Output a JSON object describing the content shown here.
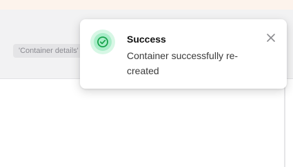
{
  "background": {
    "tooltip_text": "'Container details'"
  },
  "toast": {
    "title": "Success",
    "message": "Container successfully re-created",
    "icon": "check-circle-icon",
    "close_icon": "close-icon",
    "accent_color": "#16a34a"
  }
}
